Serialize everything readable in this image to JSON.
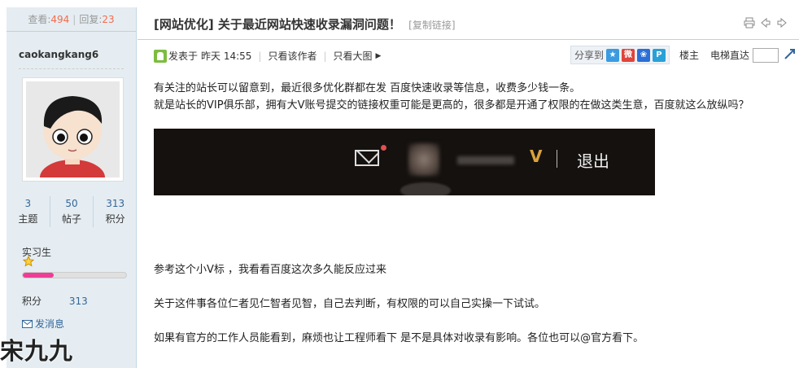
{
  "sidebar": {
    "views_label": "查看:",
    "views": "494",
    "replies_label": "回复:",
    "replies": "23",
    "username": "caokangkang6",
    "stats": [
      {
        "value": "3",
        "label": "主题"
      },
      {
        "value": "50",
        "label": "帖子"
      },
      {
        "value": "313",
        "label": "积分"
      }
    ],
    "rank": "实习生",
    "progress_percent": 30,
    "points_label": "积分",
    "points_value": "313",
    "send_message": "发消息",
    "watermark": "宋九九"
  },
  "post": {
    "title": "[网站优化] 关于最近网站快速收录漏洞问题！",
    "copy_link": "[复制链接]",
    "posted_label": "发表于",
    "posted_time": "昨天 14:55",
    "only_author": "只看该作者",
    "only_images": "只看大图",
    "share_label": "分享到",
    "floor_label": "楼主",
    "elevator_label": "电梯直达",
    "paragraphs": [
      "有关注的站长可以留意到，最近很多优化群都在发 百度快速收录等信息，收费多少钱一条。",
      "就是站长的VIP俱乐部，拥有大V账号提交的链接权重可能是更高的，很多都是开通了权限的在做这类生意，百度就这么放纵吗？"
    ],
    "screenshot_logout": "退出",
    "p2": "参考这个小V标 ，我看看百度这次多久能反应过来",
    "p3": "关于这件事各位仁者见仁智者见智，自己去判断，有权限的可以自己实操一下试试。",
    "p4": "如果有官方的工作人员能看到，麻烦也让工程师看下 是不是具体对收录有影响。各位也可以@官方看下。"
  },
  "colors": {
    "sidebar_bg": "#e5edf2",
    "link_blue": "#336699",
    "count_red": "#f26c4f",
    "progress_pink": "#ee3d96"
  }
}
